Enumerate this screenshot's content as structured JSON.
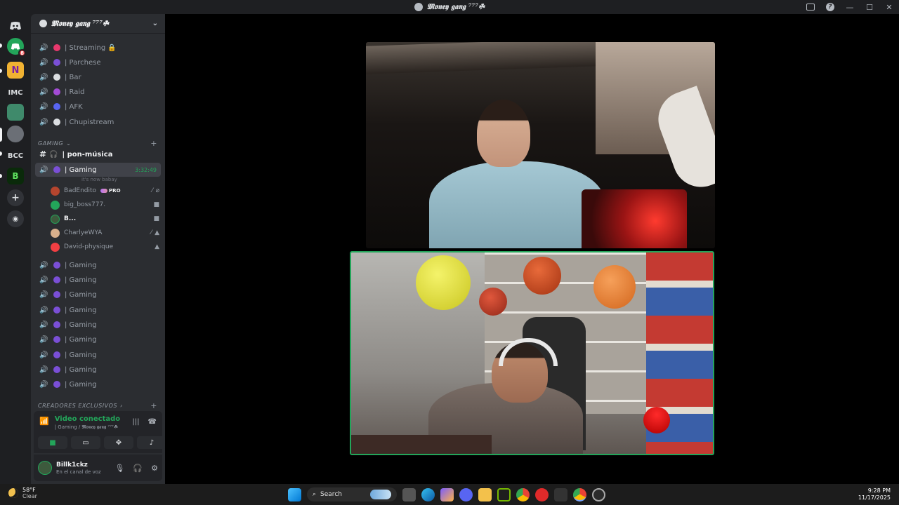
{
  "window": {
    "title": "𝕸𝖔𝖓𝖊𝖞 𝖌𝖆𝖓𝖌 ⁷⁷⁷☘"
  },
  "server": {
    "name": "𝕸𝖔𝖓𝖊𝖞 𝖌𝖆𝖓𝖌 ⁷⁷⁷☘"
  },
  "rail": {
    "text_servers": [
      "IMC",
      "BCC"
    ],
    "dm_badge": "8"
  },
  "channels_top": [
    {
      "label": "| Streaming 🔒",
      "emoji_color": "#e8386d"
    },
    {
      "label": "| Parchese",
      "emoji_color": "#7a4fd6"
    },
    {
      "label": "| Bar",
      "emoji_color": "#dbdee1"
    },
    {
      "label": "| Raid",
      "emoji_color": "#a34bd6"
    },
    {
      "label": "| AFK",
      "emoji_color": "#5865f2"
    },
    {
      "label": "| Chupistream",
      "emoji_color": "#dbdee1"
    }
  ],
  "category_gaming": "GAMING",
  "text_channel": "| pon-música",
  "active_channel": {
    "label": "| Gaming",
    "timer": "3:32:49",
    "status": "it's now babay"
  },
  "voice_users": [
    {
      "name": "BadEndito",
      "pro": "PRO",
      "color": "#b5452e"
    },
    {
      "name": "big_boss777.",
      "color": "#23a55a"
    },
    {
      "name": "B...",
      "color": "#3d5a3d"
    },
    {
      "name": "CharlyeWYA",
      "color": "#d9b08c"
    },
    {
      "name": "David-physique",
      "color": "#f23f43"
    }
  ],
  "gaming_channels": [
    "| Gaming",
    "| Gaming",
    "| Gaming",
    "| Gaming",
    "| Gaming",
    "| Gaming",
    "| Gaming",
    "| Gaming",
    "| Gaming"
  ],
  "category_creators": "CREADORES EXCLUSIVOS",
  "voice_panel": {
    "status": "Video conectado",
    "location": "| Gaming / 𝕸𝖔𝖓𝖊𝖞 𝖌𝖆𝖓𝖌 ⁷⁷⁷☘"
  },
  "user": {
    "name": "Billk1ckz",
    "status": "En el canal de voz"
  },
  "taskbar": {
    "temp": "58°F",
    "condition": "Clear",
    "search_label": "Search",
    "time": "9:28 PM",
    "date": "11/17/2025"
  }
}
